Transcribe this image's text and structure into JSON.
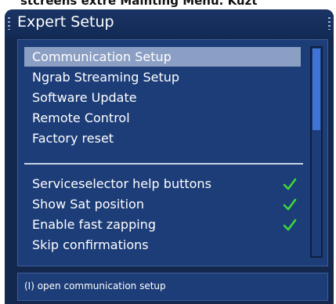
{
  "caption": "stcreens extre Mainting Menu. Kuzt",
  "title": "Expert Setup",
  "menu": {
    "items": [
      {
        "label": "Communication Setup",
        "selected": true
      },
      {
        "label": "Ngrab Streaming Setup",
        "selected": false
      },
      {
        "label": "Software Update",
        "selected": false
      },
      {
        "label": "Remote Control",
        "selected": false
      },
      {
        "label": "Factory reset",
        "selected": false
      }
    ],
    "toggles": [
      {
        "label": "Serviceselector help buttons",
        "checked": true
      },
      {
        "label": "Show Sat position",
        "checked": true
      },
      {
        "label": "Enable fast zapping",
        "checked": true
      },
      {
        "label": "Skip confirmations",
        "checked": false
      }
    ]
  },
  "status": "(I) open communication setup",
  "colors": {
    "window_bg": "#14284e",
    "panel_bg": "#1d3d78",
    "selection": "#8b9fc4",
    "check": "#3ad83a",
    "scroll_thumb": "#3f74d6"
  }
}
